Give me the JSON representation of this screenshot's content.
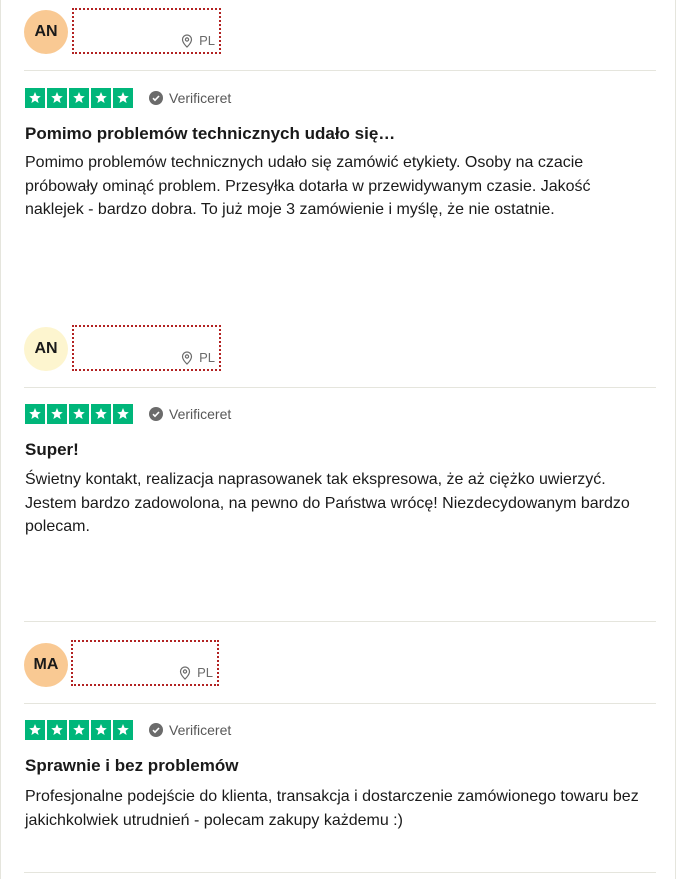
{
  "reviews": [
    {
      "initials": "AN",
      "avatar_color": "#f9c993",
      "country": "PL",
      "rating": 5,
      "verified_label": "Verificeret",
      "title": "Pomimo problemów technicznych udało się…",
      "text": "Pomimo problemów technicznych udało się zamówić etykiety. Osoby na czacie próbowały ominąć problem. Przesyłka dotarła w przewidywanym czasie. Jakość naklejek - bardzo dobra. To już moje 3 zamówienie i myślę, że nie ostatnie."
    },
    {
      "initials": "AN",
      "avatar_color": "#fdf5cf",
      "country": "PL",
      "rating": 5,
      "verified_label": "Verificeret",
      "title": "Super!",
      "text": "Świetny kontakt, realizacja naprasowanek tak ekspresowa, że aż ciężko uwierzyć. Jestem bardzo zadowolona, na pewno do Państwa wrócę! Niezdecydowanym bardzo polecam."
    },
    {
      "initials": "MA",
      "avatar_color": "#f9c993",
      "country": "PL",
      "rating": 5,
      "verified_label": "Verificeret",
      "title": "Sprawnie i bez problemów",
      "text": "Profesjonalne podejście do klienta, transakcja i dostarczenie zamówionego towaru bez jakichkolwiek utrudnień - polecam zakupy każdemu :)"
    }
  ],
  "colors": {
    "star_green": "#00b67a",
    "divider": "#e5e5dd",
    "redaction_border": "#b22222"
  }
}
